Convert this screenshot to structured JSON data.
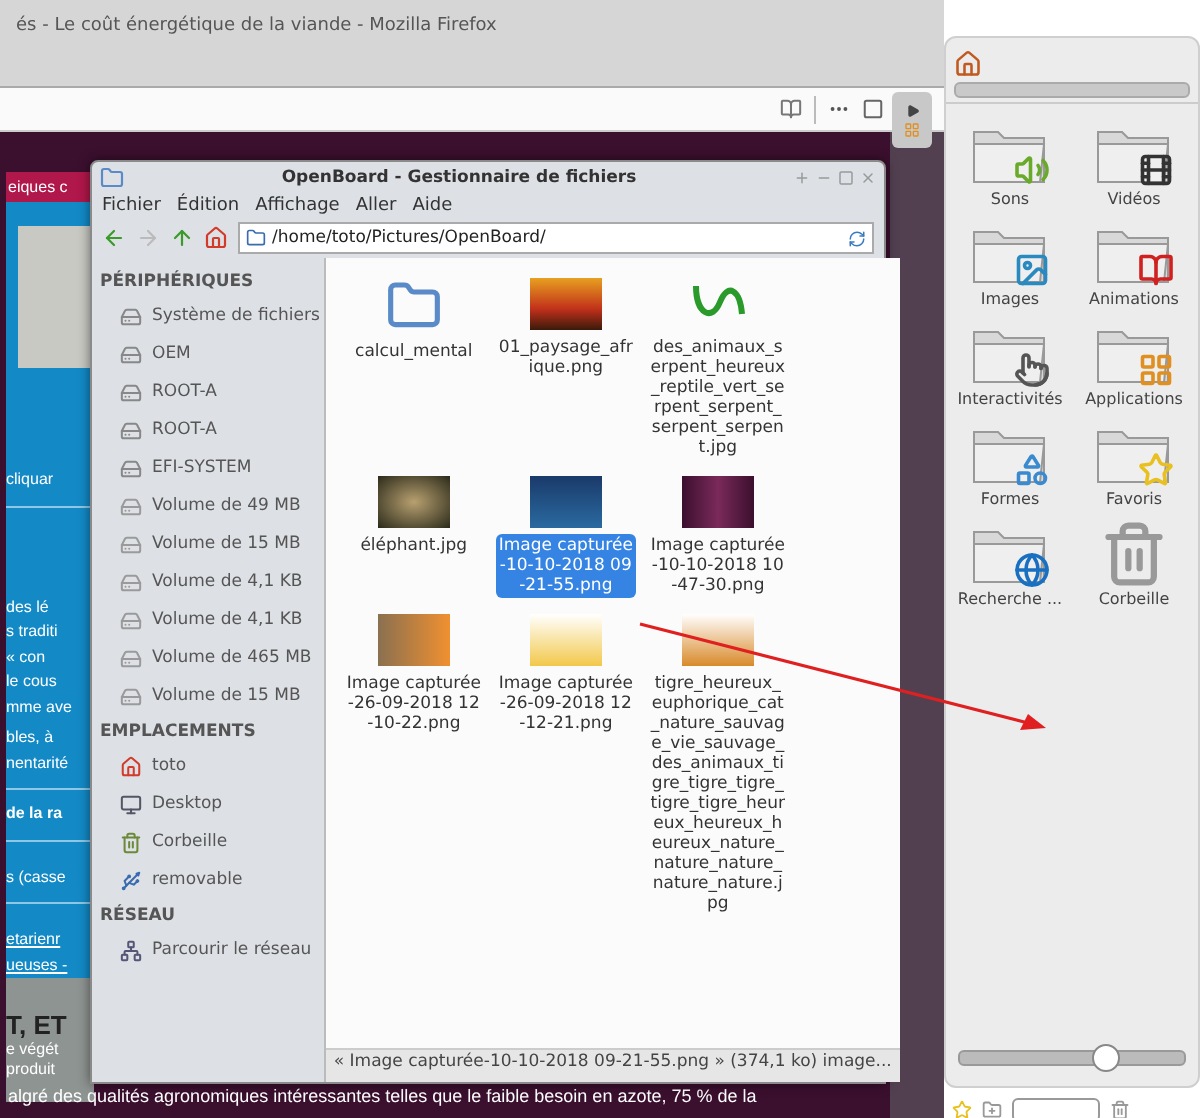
{
  "browser": {
    "title": "és - Le coût énergétique de la viande - Mozilla Firefox"
  },
  "page": {
    "banner": "eiques c",
    "intro_link": "cliquar",
    "paragraph": [
      "des lé",
      "s traditi",
      "« con",
      "le cous",
      "mme ave"
    ],
    "paragraph2": [
      "bles, à",
      "nentarité"
    ],
    "bold_line": "de la ra",
    "list_item": "s (casse",
    "links": [
      "etarienr",
      "ueuses -"
    ],
    "section_heading": "T, ET",
    "section_lines": [
      "e végét",
      "produit"
    ],
    "bottom_line": "algré des qualités agronomiques intéressantes telles que le faible besoin en azote, 75 % de la"
  },
  "file_manager": {
    "title": "OpenBoard - Gestionnaire de fichiers",
    "menu": [
      "Fichier",
      "Édition",
      "Affichage",
      "Aller",
      "Aide"
    ],
    "path": "/home/toto/Pictures/OpenBoard/",
    "sections": [
      {
        "heading": "PÉRIPHÉRIQUES",
        "items": [
          {
            "label": "Système de fichiers",
            "kind": "drive"
          },
          {
            "label": "OEM",
            "kind": "drive"
          },
          {
            "label": "ROOT-A",
            "kind": "drive"
          },
          {
            "label": "ROOT-A",
            "kind": "drive"
          },
          {
            "label": "EFI-SYSTEM",
            "kind": "drive"
          },
          {
            "label": "Volume de 49 MB",
            "kind": "volume"
          },
          {
            "label": "Volume de 15 MB",
            "kind": "volume"
          },
          {
            "label": "Volume de 4,1 KB",
            "kind": "volume"
          },
          {
            "label": "Volume de 4,1 KB",
            "kind": "volume"
          },
          {
            "label": "Volume de 465 MB",
            "kind": "volume"
          },
          {
            "label": "Volume de 15 MB",
            "kind": "volume"
          }
        ]
      },
      {
        "heading": "EMPLACEMENTS",
        "items": [
          {
            "label": "toto",
            "kind": "home"
          },
          {
            "label": "Desktop",
            "kind": "desktop"
          },
          {
            "label": "Corbeille",
            "kind": "trash"
          },
          {
            "label": "removable",
            "kind": "removable"
          }
        ]
      },
      {
        "heading": "RÉSEAU",
        "items": [
          {
            "label": "Parcourir le réseau",
            "kind": "network"
          }
        ]
      }
    ],
    "files": [
      {
        "name": "calcul_mental",
        "kind": "folder",
        "selected": false
      },
      {
        "name": "01_paysage_afrique.png",
        "kind": "sunset",
        "selected": false
      },
      {
        "name": "des_animaux_serpent_heureux_reptile_vert_serpent_serpent_serpent_serpent.jpg",
        "kind": "snake",
        "selected": false
      },
      {
        "name": "éléphant.jpg",
        "kind": "elephant",
        "selected": false
      },
      {
        "name": "Image capturée-10-10-2018 09-21-55.png",
        "kind": "ocean",
        "selected": true
      },
      {
        "name": "Image capturée-10-10-2018 10-47-30.png",
        "kind": "webpage",
        "selected": false
      },
      {
        "name": "Image capturée-26-09-2018 12-10-22.png",
        "kind": "letter",
        "selected": false
      },
      {
        "name": "Image capturée-26-09-2018 12-12-21.png",
        "kind": "giraffe",
        "selected": false
      },
      {
        "name": "tigre_heureux_euphorique_cat_nature_sauvage_vie_sauvage_des_animaux_tigre_tigre_tigre_tigre_tigre_heureux_heureux_heureux_nature_nature_nature_nature_nature.jpg",
        "kind": "tiger",
        "selected": false
      }
    ],
    "status": "« Image capturée-10-10-2018 09-21-55.png » (374,1 ko) image..."
  },
  "library": {
    "items": [
      {
        "label": "Sons",
        "kind": "sounds"
      },
      {
        "label": "Vidéos",
        "kind": "videos"
      },
      {
        "label": "Images",
        "kind": "images"
      },
      {
        "label": "Animations",
        "kind": "animations"
      },
      {
        "label": "Interactivités",
        "kind": "interactive"
      },
      {
        "label": "Applications",
        "kind": "applications"
      },
      {
        "label": "Formes",
        "kind": "shapes"
      },
      {
        "label": "Favoris",
        "kind": "favorites"
      },
      {
        "label": "Recherche ...",
        "kind": "search"
      },
      {
        "label": "Corbeille",
        "kind": "trash"
      }
    ],
    "zoom_slider": {
      "level": 0.64
    }
  }
}
